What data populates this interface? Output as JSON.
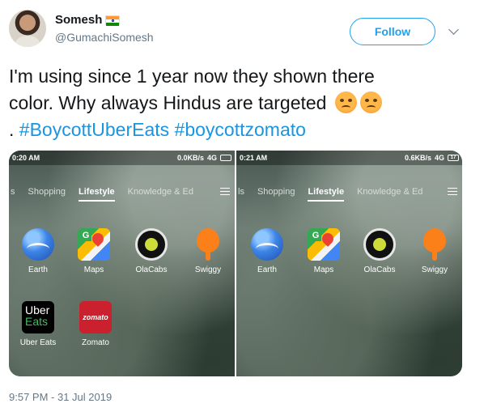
{
  "user": {
    "display_name": "Somesh",
    "handle": "@GumachiSomesh",
    "flag_icon": "india-flag-emoji"
  },
  "follow_button": {
    "label": "Follow",
    "color": "#1da1f2"
  },
  "tweet": {
    "line1": "I'm using since 1 year now they shown there",
    "line2_text": "color. Why always Hindus are targeted",
    "emojis": [
      "angry-face-emoji",
      "angry-face-emoji"
    ],
    "line3_prefix": ".",
    "hashtags": [
      "#BoycottUberEats",
      "#boycottzomato"
    ],
    "hashtag_color": "#1b95e0"
  },
  "screenshots": [
    {
      "status_time": "0:20 AM",
      "status_right": "0.0KB/s",
      "network": "4G",
      "battery": "",
      "tabs": [
        "s",
        "Shopping",
        "Lifestyle",
        "Knowledge & Ed"
      ],
      "active_tab": "Lifestyle",
      "apps": [
        {
          "label": "Earth",
          "icon": "google-earth-icon"
        },
        {
          "label": "Maps",
          "icon": "google-maps-icon"
        },
        {
          "label": "OlaCabs",
          "icon": "ola-cabs-icon"
        },
        {
          "label": "Swiggy",
          "icon": "swiggy-icon"
        },
        {
          "label": "Uber Eats",
          "icon": "uber-eats-icon",
          "icon_text": [
            "Uber",
            "Eats"
          ]
        },
        {
          "label": "Zomato",
          "icon": "zomato-icon",
          "icon_text": "zomato"
        }
      ]
    },
    {
      "status_time": "0:21 AM",
      "status_right": "0.6KB/s",
      "network": "4G",
      "battery": "17",
      "tabs": [
        "ls",
        "Shopping",
        "Lifestyle",
        "Knowledge & Ed"
      ],
      "active_tab": "Lifestyle",
      "apps": [
        {
          "label": "Earth",
          "icon": "google-earth-icon"
        },
        {
          "label": "Maps",
          "icon": "google-maps-icon"
        },
        {
          "label": "OlaCabs",
          "icon": "ola-cabs-icon"
        },
        {
          "label": "Swiggy",
          "icon": "swiggy-icon"
        }
      ]
    }
  ],
  "timestamp": "9:57 PM - 31 Jul 2019"
}
